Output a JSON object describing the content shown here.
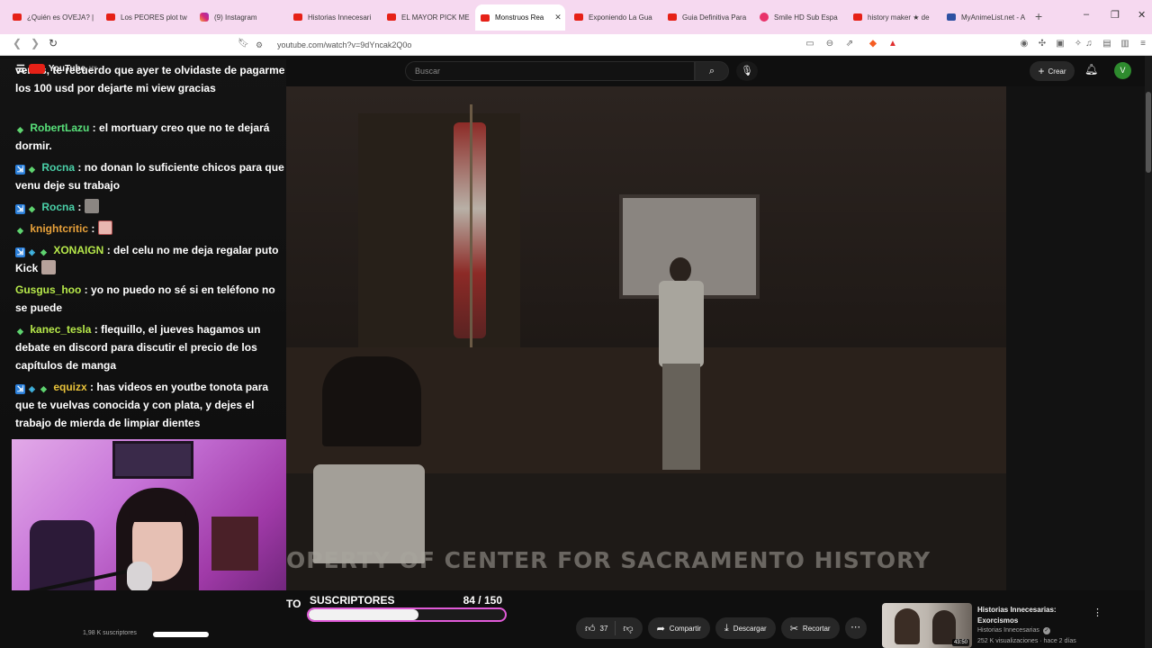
{
  "browser": {
    "tabs": [
      {
        "title": "¿Quién es OVEJA? |",
        "favicon": "youtube-icon",
        "active": false
      },
      {
        "title": "Los PEORES plot tw",
        "favicon": "youtube-icon",
        "active": false
      },
      {
        "title": "(9) Instagram",
        "favicon": "instagram-icon",
        "active": false
      },
      {
        "title": "Historias Innecesari",
        "favicon": "youtube-icon",
        "active": false
      },
      {
        "title": "EL MAYOR PICK ME",
        "favicon": "youtube-icon",
        "active": false
      },
      {
        "title": "Monstruos Rea",
        "favicon": "youtube-icon",
        "active": true
      },
      {
        "title": "Exponiendo La Gua",
        "favicon": "youtube-icon",
        "active": false
      },
      {
        "title": "Guia Definitiva Para",
        "favicon": "youtube-icon",
        "active": false
      },
      {
        "title": "Smile HD Sub Espa",
        "favicon": "record-icon",
        "active": false
      },
      {
        "title": "history maker ★ de",
        "favicon": "youtube-icon",
        "active": false
      },
      {
        "title": "MyAnimeList.net - A",
        "favicon": "myanimelist-icon",
        "active": false
      }
    ],
    "new_tab": "+",
    "window_controls": [
      "–",
      "❐",
      "✕"
    ],
    "url": "youtube.com/watch?v=9dYncak2Q0o",
    "brand_color": "#f6d9f0"
  },
  "youtube": {
    "search_placeholder": "Buscar",
    "create_label": "Crear",
    "avatar_letter": "V",
    "channel_overlay_text": "YouTube",
    "channel_overlay_sup": "UY"
  },
  "chat": [
    {
      "badges": [],
      "user": "",
      "name_color": "#ffffff",
      "text": "venus, te recuerdo que ayer te olvidaste de pagarme los 100 usd por dejarte mi view gracias"
    },
    {
      "badges": [
        "leaf"
      ],
      "user": "RobertLazu",
      "name_color": "#58e07a",
      "text": "el mortuary creo que no te dejará dormir."
    },
    {
      "badges": [
        "sub",
        "leaf"
      ],
      "user": "Rocna",
      "name_color": "#4ad0a8",
      "text": "no donan lo suficiente chicos para que venu deje su trabajo"
    },
    {
      "badges": [
        "sub",
        "leaf"
      ],
      "user": "Rocna",
      "name_color": "#4ad0a8",
      "text": "",
      "emote": "cat"
    },
    {
      "badges": [
        "leaf"
      ],
      "user": "knightcritic",
      "name_color": "#e8a13a",
      "text": "",
      "emote": "girl"
    },
    {
      "badges": [
        "sub",
        "gem",
        "leaf"
      ],
      "user": "XONAIGN",
      "name_color": "#b6e84a",
      "text": "del celu no me deja regalar puto Kick",
      "emote": "pic"
    },
    {
      "badges": [],
      "user": "Gusgus_hoo",
      "name_color": "#b6e84a",
      "text": "yo no puedo no sé si en teléfono no se puede"
    },
    {
      "badges": [
        "leaf"
      ],
      "user": "kanec_tesla",
      "name_color": "#b6e84a",
      "text": "flequillo, el jueves hagamos un debate en discord para discutir el precio de los capítulos de manga"
    },
    {
      "badges": [
        "sub",
        "gem",
        "leaf"
      ],
      "user": "equizx",
      "name_color": "#e8c23a",
      "text": "has videos en youtbe tonota para que te vuelvas conocida y con plata, y dejes el trabajo de mierda de limpiar dientes"
    }
  ],
  "video": {
    "watermark": "OPERTY OF CENTER FOR SACRAMENTO HISTORY"
  },
  "sub_goal": {
    "label": "SUSCRIPTORES",
    "count_text": "84  / 150",
    "current": 84,
    "target": 150,
    "cut_text": "TO",
    "subs_text": "1,98 K suscriptores"
  },
  "actions": {
    "likes": "37",
    "share": "Compartir",
    "download": "Descargar",
    "clip": "Recortar",
    "more": "⋯"
  },
  "recommended": {
    "title": "Historias Innecesarias: Exorcismos",
    "channel": "Historias Innecesarias",
    "meta": "252 K visualizaciones · hace 2 días",
    "duration": "43:50"
  }
}
